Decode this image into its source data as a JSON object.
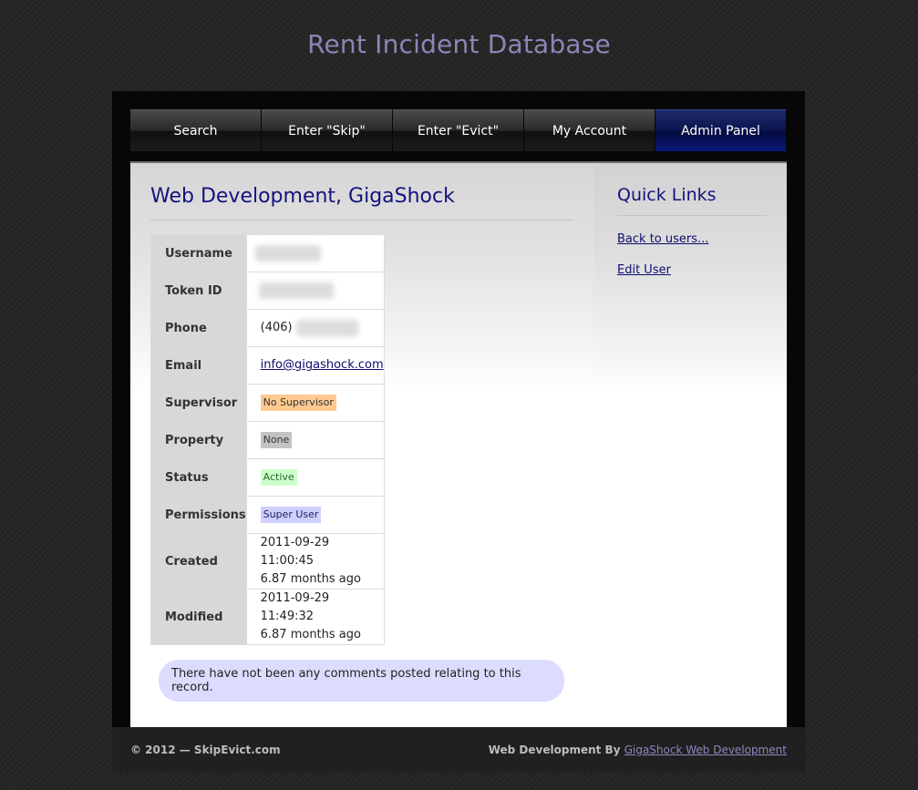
{
  "site_title": "Rent Incident Database",
  "nav": {
    "tabs": [
      {
        "label": "Search"
      },
      {
        "label": "Enter \"Skip\""
      },
      {
        "label": "Enter \"Evict\""
      },
      {
        "label": "My Account"
      },
      {
        "label": "Admin Panel"
      }
    ],
    "active_tab": "Admin Panel"
  },
  "main": {
    "title": "Web Development, GigaShock",
    "fields": {
      "username_label": "Username",
      "token_label": "Token ID",
      "phone_label": "Phone",
      "phone_value": "(406)",
      "email_label": "Email",
      "email_value": "info@gigashock.com",
      "supervisor_label": "Supervisor",
      "supervisor_value": "No Supervisor",
      "property_label": "Property",
      "property_value": "None",
      "status_label": "Status",
      "status_value": "Active",
      "permissions_label": "Permissions",
      "permissions_value": "Super User",
      "created_label": "Created",
      "created_date": "2011-09-29 11:00:45",
      "created_ago": "6.87 months ago",
      "modified_label": "Modified",
      "modified_date": "2011-09-29 11:49:32",
      "modified_ago": "6.87 months ago"
    },
    "comments_message": "There have not been any comments posted relating to this record."
  },
  "sidebar": {
    "title": "Quick Links",
    "links": [
      {
        "label": "Back to users..."
      },
      {
        "label": "Edit User"
      }
    ]
  },
  "footer": {
    "copyright": "© 2012 — SkipEvict.com",
    "credit_prefix": "Web Development By",
    "credit_link": "GigaShock Web Development"
  },
  "colors": {
    "title": "#8a86b8",
    "heading": "#13137e",
    "supervisor_badge": "#ffc98f",
    "property_badge": "#c3c3c3",
    "status_badge": "#ccffcc",
    "permissions_badge": "#cfcfff",
    "comment_box": "#dcdcff"
  }
}
